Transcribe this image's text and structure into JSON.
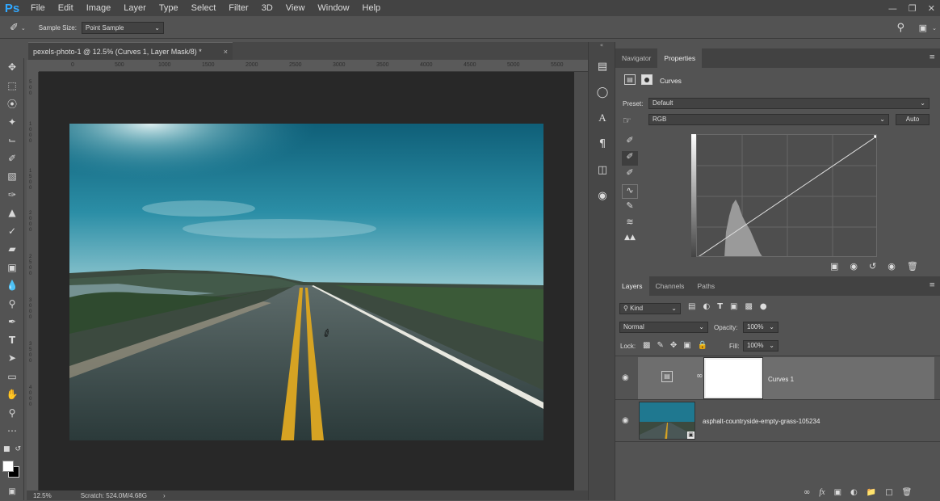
{
  "app": {
    "logo": "Ps"
  },
  "menu": [
    "File",
    "Edit",
    "Image",
    "Layer",
    "Type",
    "Select",
    "Filter",
    "3D",
    "View",
    "Window",
    "Help"
  ],
  "options_bar": {
    "sample_size_label": "Sample Size:",
    "sample_size_value": "Point Sample"
  },
  "document": {
    "tab_title": "pexels-photo-1 @ 12.5% (Curves 1, Layer Mask/8) *",
    "ruler_h_ticks": [
      "0",
      "500",
      "1000",
      "1500",
      "2000",
      "2500",
      "3000",
      "3500",
      "4000",
      "4500",
      "5000",
      "5500"
    ],
    "ruler_v_ticks": [
      "5 0 0",
      "1 0 0 0",
      "1 5 0 0",
      "2 0 0 0",
      "2 5 0 0",
      "3 0 0 0",
      "3 5 0 0",
      "4 0 0 0"
    ]
  },
  "status": {
    "zoom": "12.5%",
    "scratch": "Scratch: 524.0M/4.68G"
  },
  "properties": {
    "tabs": [
      "Navigator",
      "Properties"
    ],
    "active_tab": "Properties",
    "adjustment_name": "Curves",
    "preset_label": "Preset:",
    "preset_value": "Default",
    "channel_value": "RGB",
    "auto_button": "Auto"
  },
  "layers": {
    "tabs": [
      "Layers",
      "Channels",
      "Paths"
    ],
    "active_tab": "Layers",
    "filter_kind": "Kind",
    "blend_mode": "Normal",
    "opacity_label": "Opacity:",
    "opacity_value": "100%",
    "lock_label": "Lock:",
    "fill_label": "Fill:",
    "fill_value": "100%",
    "items": [
      {
        "name": "Curves 1",
        "selected": true
      },
      {
        "name": "asphalt-countryside-empty-grass-105234",
        "selected": false
      }
    ]
  },
  "colors": {
    "accent": "#31a8ff",
    "panel": "#535353",
    "canvas_bg": "#282828"
  }
}
